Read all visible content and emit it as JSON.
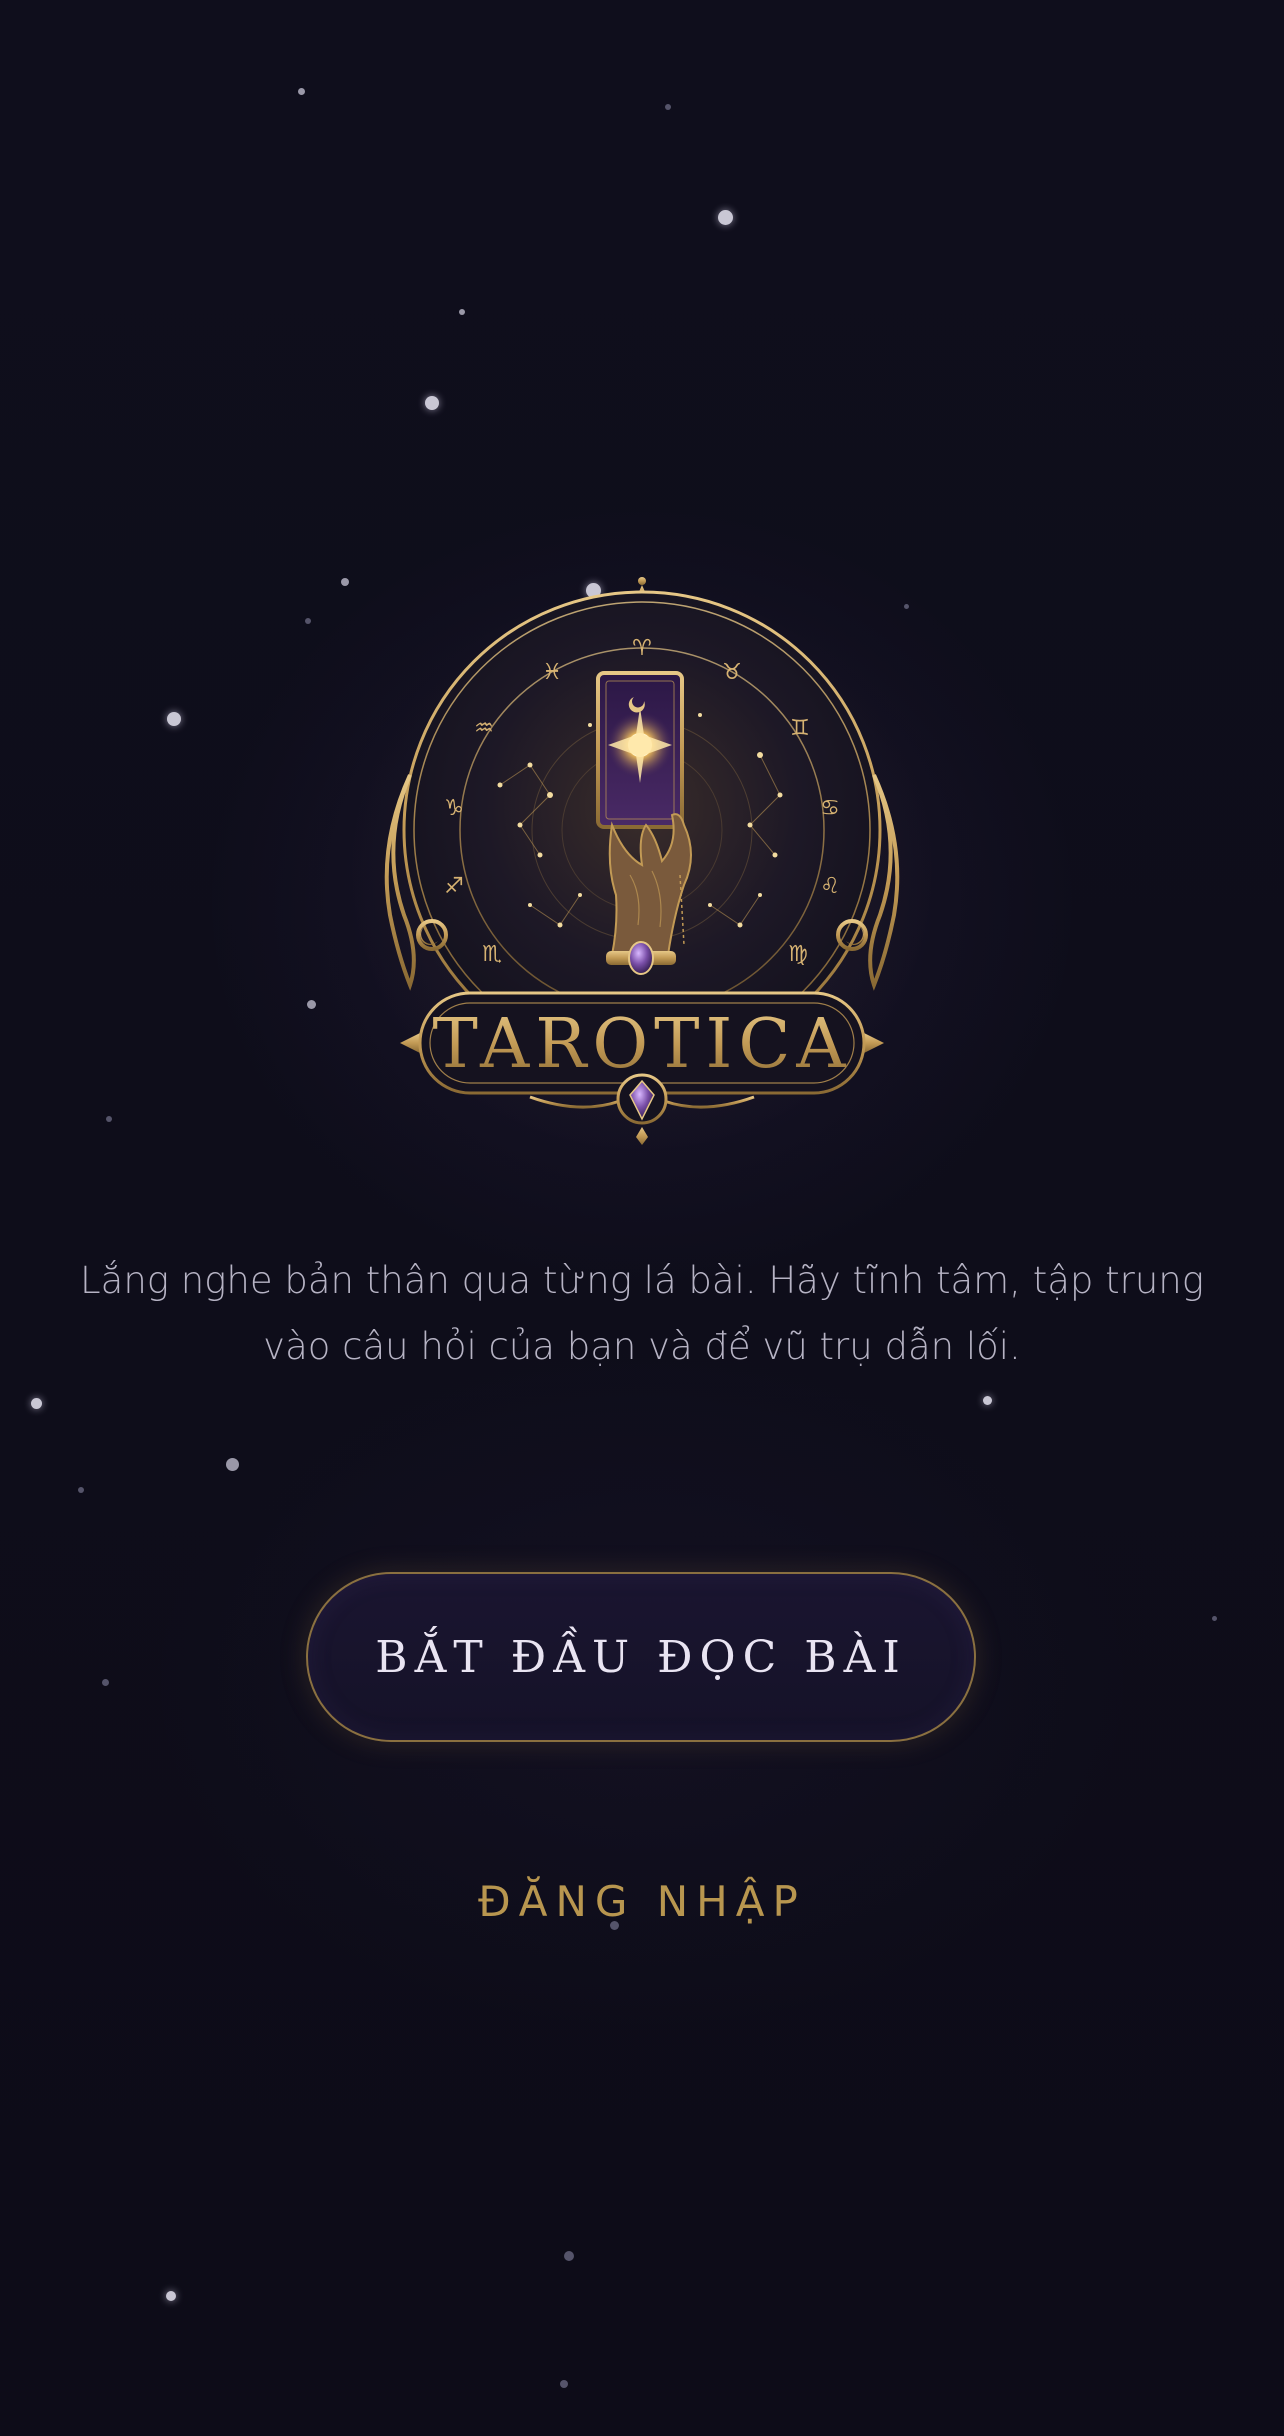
{
  "brand": {
    "name": "TAROTICA"
  },
  "intro": {
    "line1": "Lắng nghe bản thân qua từng lá bài. Hãy tĩnh tâm, tập trung",
    "line2": "vào câu hỏi của bạn và để vũ trụ dẫn lối."
  },
  "actions": {
    "start_label": "BẮT ĐẦU ĐỌC BÀI",
    "login_label": "ĐĂNG NHẬP"
  },
  "icons": {
    "logo": "tarot-card-hand-zodiac-emblem",
    "background": "starfield"
  },
  "colors": {
    "background": "#0e0d1a",
    "gold": "#b8964f",
    "button_border": "#8a7040",
    "button_fill": "#1a1530",
    "text_muted": "#b6b3c4",
    "amethyst": "#7a4fa8"
  }
}
